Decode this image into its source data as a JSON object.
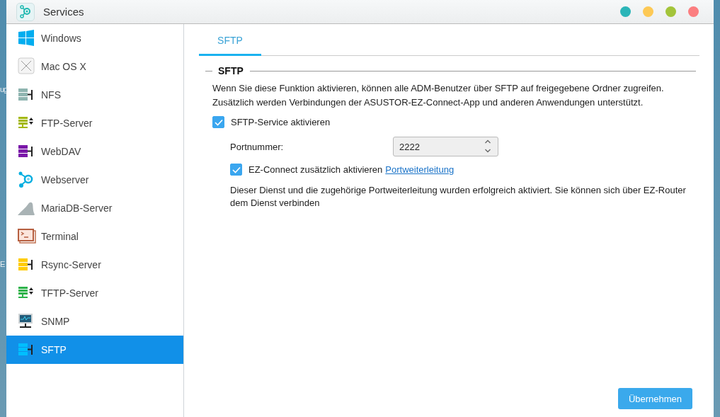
{
  "desktop": {
    "labels": [
      "ug",
      "E"
    ]
  },
  "window": {
    "title": "Services",
    "controls": [
      {
        "color": "#2bb5b8"
      },
      {
        "color": "#fdc955"
      },
      {
        "color": "#a3c43a"
      },
      {
        "color": "#fb7e80"
      }
    ]
  },
  "sidebar": {
    "items": [
      {
        "label": "Windows",
        "kind": "windows",
        "selected": false
      },
      {
        "label": "Mac OS X",
        "kind": "mac",
        "selected": false
      },
      {
        "label": "NFS",
        "kind": "server",
        "color": "#8fb5b0",
        "selected": false
      },
      {
        "label": "FTP-Server",
        "kind": "transfer",
        "color": "#a3b80e",
        "selected": false
      },
      {
        "label": "WebDAV",
        "kind": "server",
        "color": "#7a17a8",
        "selected": false
      },
      {
        "label": "Webserver",
        "kind": "webserver",
        "selected": false
      },
      {
        "label": "MariaDB-Server",
        "kind": "database",
        "selected": false
      },
      {
        "label": "Terminal",
        "kind": "terminal",
        "selected": false
      },
      {
        "label": "Rsync-Server",
        "kind": "server",
        "color": "#ffcc00",
        "selected": false
      },
      {
        "label": "TFTP-Server",
        "kind": "transfer",
        "color": "#2db34a",
        "selected": false
      },
      {
        "label": "SNMP",
        "kind": "monitor",
        "selected": false
      },
      {
        "label": "SFTP",
        "kind": "server",
        "color": "#00bfff",
        "selected": true
      }
    ]
  },
  "tabs": [
    {
      "label": "SFTP",
      "selected": true
    }
  ],
  "section": {
    "title": "SFTP",
    "description": "Wenn Sie diese Funktion aktivieren, können alle ADM-Benutzer über SFTP auf freigegebene Ordner zugreifen. Zusätzlich werden Verbindungen der ASUSTOR-EZ-Connect-App und anderen Anwendungen unterstützt.",
    "enable": {
      "label": "SFTP-Service aktivieren",
      "checked": true
    },
    "port": {
      "label": "Portnummer:",
      "value": "2222"
    },
    "ez_connect": {
      "label": "EZ-Connect zusätzlich aktivieren",
      "link": "Portweiterleitung",
      "checked": true
    },
    "message": "Dieser Dienst und die zugehörige Portweiterleitung wurden erfolgreich aktiviert. Sie können sich über EZ-Router dem Dienst verbinden"
  },
  "buttons": [
    "Übernehmen"
  ]
}
